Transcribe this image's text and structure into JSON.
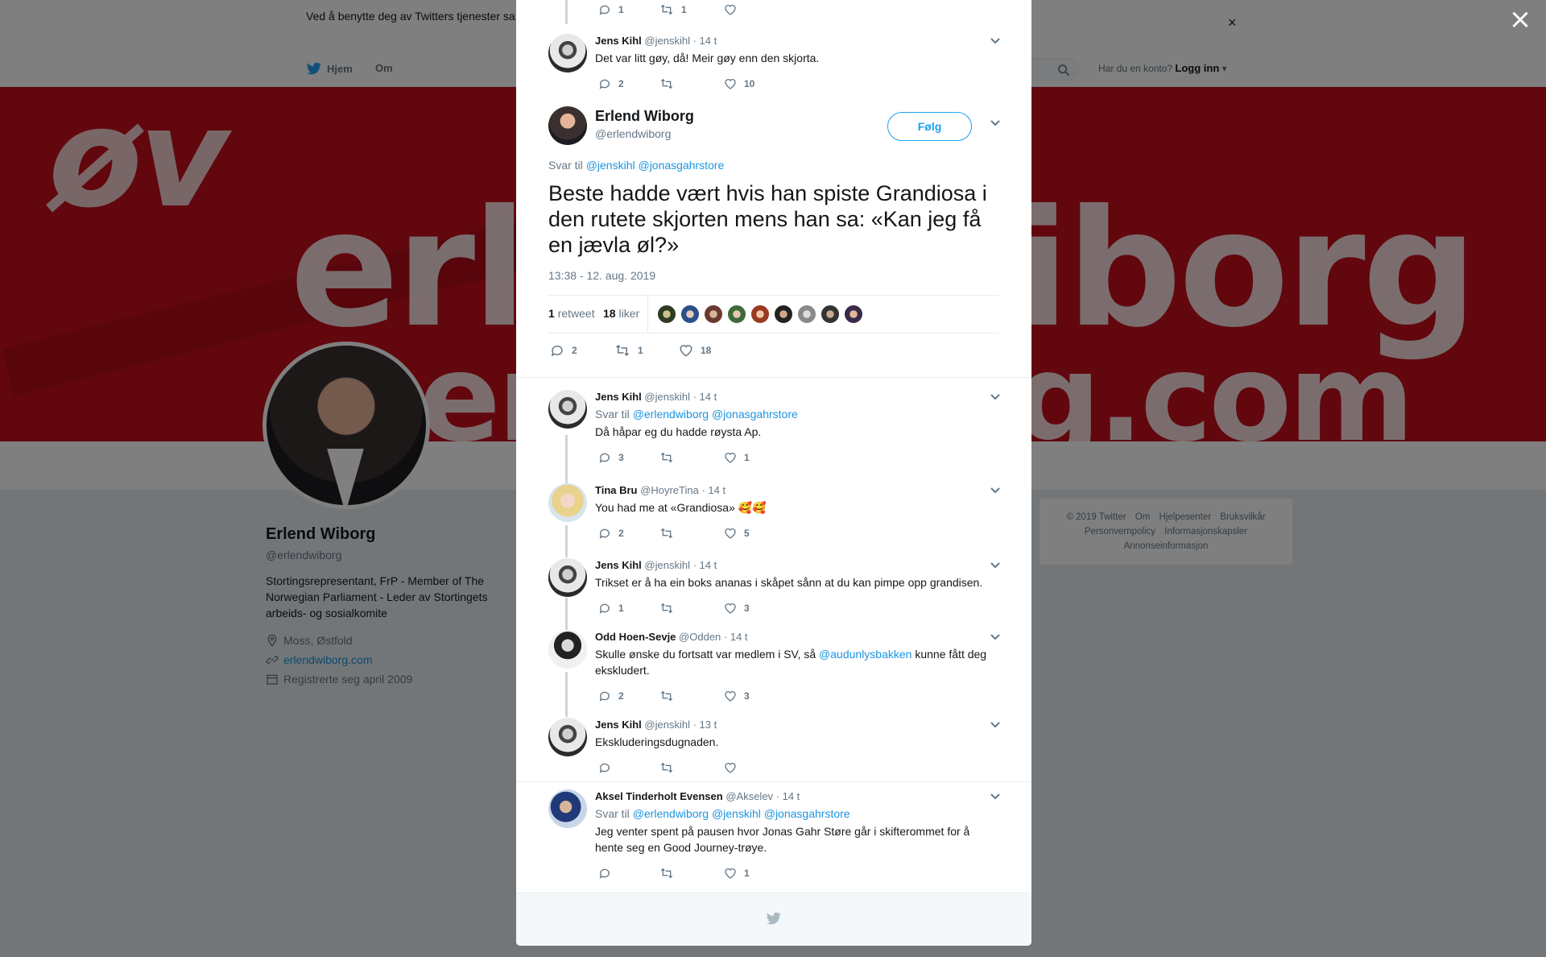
{
  "cookie_bar": {
    "text": "Ved å benytte deg av Twitters tjenester sa                                                                                                                                   informasjonskapsler til bl.a. analyser, personalisering og annonser.",
    "close": "×"
  },
  "top_nav": {
    "home": "Hjem",
    "about": "Om",
    "login_prompt": "Har du en konto?",
    "login": "Logg inn"
  },
  "banner": {
    "w1": "erl",
    "w2": "iborg",
    "w3": "øv",
    "w4": "er",
    "w5": "g.com"
  },
  "profile": {
    "name": "Erlend Wiborg",
    "handle": "@erlendwiborg",
    "bio": "Stortingsrepresentant, FrP - Member of The Norwegian Parliament - Leder av Stortingets arbeids- og sosialkomite",
    "location": "Moss, Østfold",
    "website": "erlendwiborg.com",
    "joined": "Registrerte seg april 2009"
  },
  "footer": {
    "links": [
      "© 2019 Twitter",
      "Om",
      "Hjelpesenter",
      "Bruksvilkår",
      "Personvernpolicy",
      "Informasjonskapsler",
      "Annonseinformasjon"
    ]
  },
  "overlay_close": "×",
  "thread_above": [
    {
      "actions": {
        "reply": "1",
        "retweet": "1",
        "like": ""
      }
    },
    {
      "name": "Jens Kihl",
      "handle": "@jenskihl",
      "time": "· 14 t",
      "text": "Det var litt gøy, då! Meir gøy enn den skjorta.",
      "actions": {
        "reply": "2",
        "retweet": "",
        "like": "10"
      }
    }
  ],
  "main_tweet": {
    "name": "Erlend Wiborg",
    "handle": "@erlendwiborg",
    "follow": "Følg",
    "reply_label": "Svar til",
    "reply_mentions": "@jenskihl @jonasgahrstore",
    "text": "Beste hadde vært hvis han spiste Grandiosa i den rutete skjorten mens han sa: «Kan jeg få en jævla øl?»",
    "timestamp": "13:38 - 12. aug. 2019",
    "retweets_count": "1",
    "retweets_label": "retweet",
    "likes_count": "18",
    "likes_label": "liker",
    "actions": {
      "reply": "2",
      "retweet": "1",
      "like": "18"
    }
  },
  "replies": [
    {
      "name": "Jens Kihl",
      "handle": "@jenskihl",
      "time": "· 14 t",
      "reply_label": "Svar til",
      "reply_mentions": "@erlendwiborg @jonasgahrstore",
      "text": "Då håpar eg du hadde røysta Ap.",
      "actions": {
        "reply": "3",
        "retweet": "",
        "like": "1"
      }
    },
    {
      "name": "Tina Bru",
      "handle": "@HoyreTina",
      "time": "· 14 t",
      "text": "You had me at «Grandiosa» 🥰🥰",
      "actions": {
        "reply": "2",
        "retweet": "",
        "like": "5"
      }
    },
    {
      "name": "Jens Kihl",
      "handle": "@jenskihl",
      "time": "· 14 t",
      "text": "Trikset er å ha ein boks ananas i skåpet sånn at du kan pimpe opp grandisen.",
      "actions": {
        "reply": "1",
        "retweet": "",
        "like": "3"
      }
    },
    {
      "name": "Odd Hoen-Sevje",
      "handle": "@Odden",
      "time": "· 14 t",
      "text_before": "Skulle ønske du fortsatt var medlem i SV, så",
      "text_mention": "@audunlysbakken",
      "text_after": "kunne fått deg ekskludert.",
      "actions": {
        "reply": "2",
        "retweet": "",
        "like": "3"
      }
    },
    {
      "name": "Jens Kihl",
      "handle": "@jenskihl",
      "time": "· 13 t",
      "text": "Ekskluderingsdugnaden.",
      "actions": {
        "reply": "",
        "retweet": "",
        "like": ""
      }
    },
    {
      "name": "Aksel Tinderholt Evensen",
      "handle": "@Akselev",
      "time": "· 14 t",
      "reply_label": "Svar til",
      "reply_mentions": "@erlendwiborg @jenskihl @jonasgahrstore",
      "text": "Jeg venter spent på pausen hvor Jonas Gahr Støre går i skifterommet for å hente seg en Good Journey-trøye.",
      "actions": {
        "reply": "",
        "retweet": "",
        "like": "1"
      }
    }
  ],
  "colors": {
    "accent": "#1da1f2",
    "link": "#1b95e0",
    "banner_red": "#c40f1c",
    "muted": "#657786"
  }
}
